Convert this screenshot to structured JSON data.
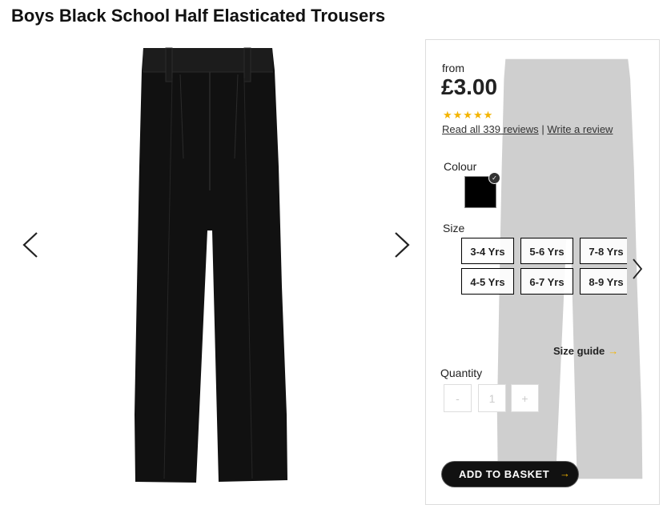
{
  "product": {
    "title": "Boys Black School Half Elasticated Trousers",
    "from_label": "from",
    "price": "£3.00",
    "rating_stars": "★★★★★",
    "rating_value": 4.5,
    "reviews_link": "Read all 339 reviews",
    "reviews_separator": "|",
    "write_review_link": "Write a review"
  },
  "gallery": {
    "prev_icon": "chevron-left-icon",
    "next_icon": "chevron-right-icon"
  },
  "colour": {
    "label": "Colour",
    "selected": "black",
    "swatch_color": "#000000"
  },
  "size": {
    "label": "Size",
    "options": [
      "3-4 Yrs",
      "5-6 Yrs",
      "7-8 Yrs",
      "4-5 Yrs",
      "6-7 Yrs",
      "8-9 Yrs"
    ],
    "guide_label": "Size guide",
    "guide_arrow": "→"
  },
  "quantity": {
    "label": "Quantity",
    "minus": "-",
    "value": "1",
    "plus": "+"
  },
  "basket": {
    "label": "ADD TO BASKET",
    "arrow": "→"
  },
  "colors": {
    "accent": "#f4b400",
    "button": "#111111"
  }
}
